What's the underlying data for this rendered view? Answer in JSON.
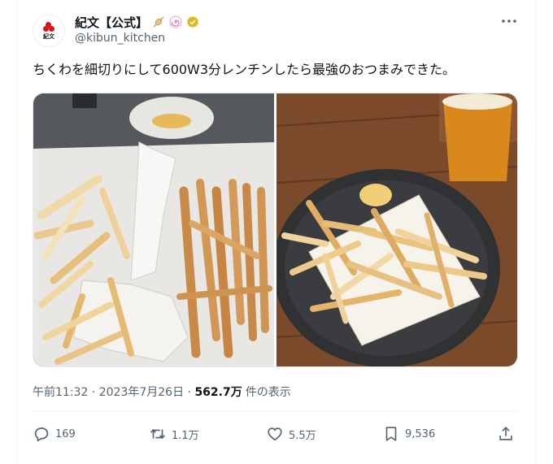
{
  "account": {
    "display_name": "紀文【公式】",
    "handle": "@kibun_kitchen",
    "avatar_text": "紀文"
  },
  "tweet": {
    "text": "ちくわを細切りにして600W3分レンチンしたら最強のおつまみできた。",
    "time": "午前11:32",
    "sep1": " · ",
    "date": "2023年7月26日",
    "sep2": " · ",
    "views": "562.7万",
    "views_label": "件の表示"
  },
  "actions": {
    "replies": "169",
    "reposts": "1.1万",
    "likes": "5.5万",
    "bookmarks": "9,536"
  },
  "colors": {
    "muted": "#536471",
    "verified": "#e2b719",
    "brand_red": "#d7141a"
  },
  "icons": [
    "chikuwa-skewer-icon",
    "naruto-icon",
    "verified-badge-icon",
    "more-icon",
    "reply-icon",
    "repost-icon",
    "like-icon",
    "bookmark-icon",
    "share-icon"
  ]
}
